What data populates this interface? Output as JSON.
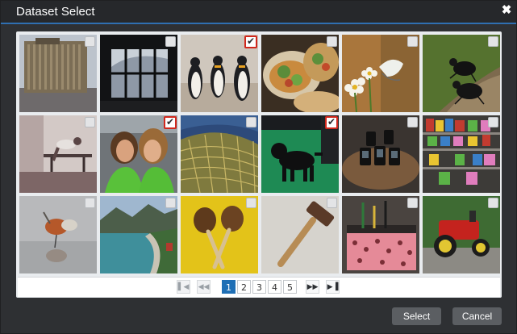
{
  "dialog": {
    "title": "Dataset Select",
    "close_icon": "close-icon"
  },
  "images": [
    {
      "name": "radiator",
      "checked": false
    },
    {
      "name": "window-silhouette",
      "checked": false
    },
    {
      "name": "penguins",
      "checked": true
    },
    {
      "name": "food-plate",
      "checked": false
    },
    {
      "name": "butterfly-flowers",
      "checked": false
    },
    {
      "name": "beetle",
      "checked": false
    },
    {
      "name": "workout-room",
      "checked": false
    },
    {
      "name": "women-selfie",
      "checked": true
    },
    {
      "name": "fishing-net",
      "checked": false
    },
    {
      "name": "black-dog",
      "checked": true
    },
    {
      "name": "phones-table",
      "checked": false
    },
    {
      "name": "store-shelves",
      "checked": false
    },
    {
      "name": "bird-reflection",
      "checked": false
    },
    {
      "name": "lake-road",
      "checked": false
    },
    {
      "name": "maracas",
      "checked": false
    },
    {
      "name": "hammer",
      "checked": false
    },
    {
      "name": "tool-apron",
      "checked": false
    },
    {
      "name": "red-tractor",
      "checked": false
    }
  ],
  "pagination": {
    "pages": [
      "1",
      "2",
      "3",
      "4",
      "5"
    ],
    "current": "1",
    "first_icon": "first-page-icon",
    "prev_icon": "prev-page-icon",
    "next_icon": "next-page-icon",
    "last_icon": "last-page-icon"
  },
  "footer": {
    "select_label": "Select",
    "cancel_label": "Cancel"
  }
}
